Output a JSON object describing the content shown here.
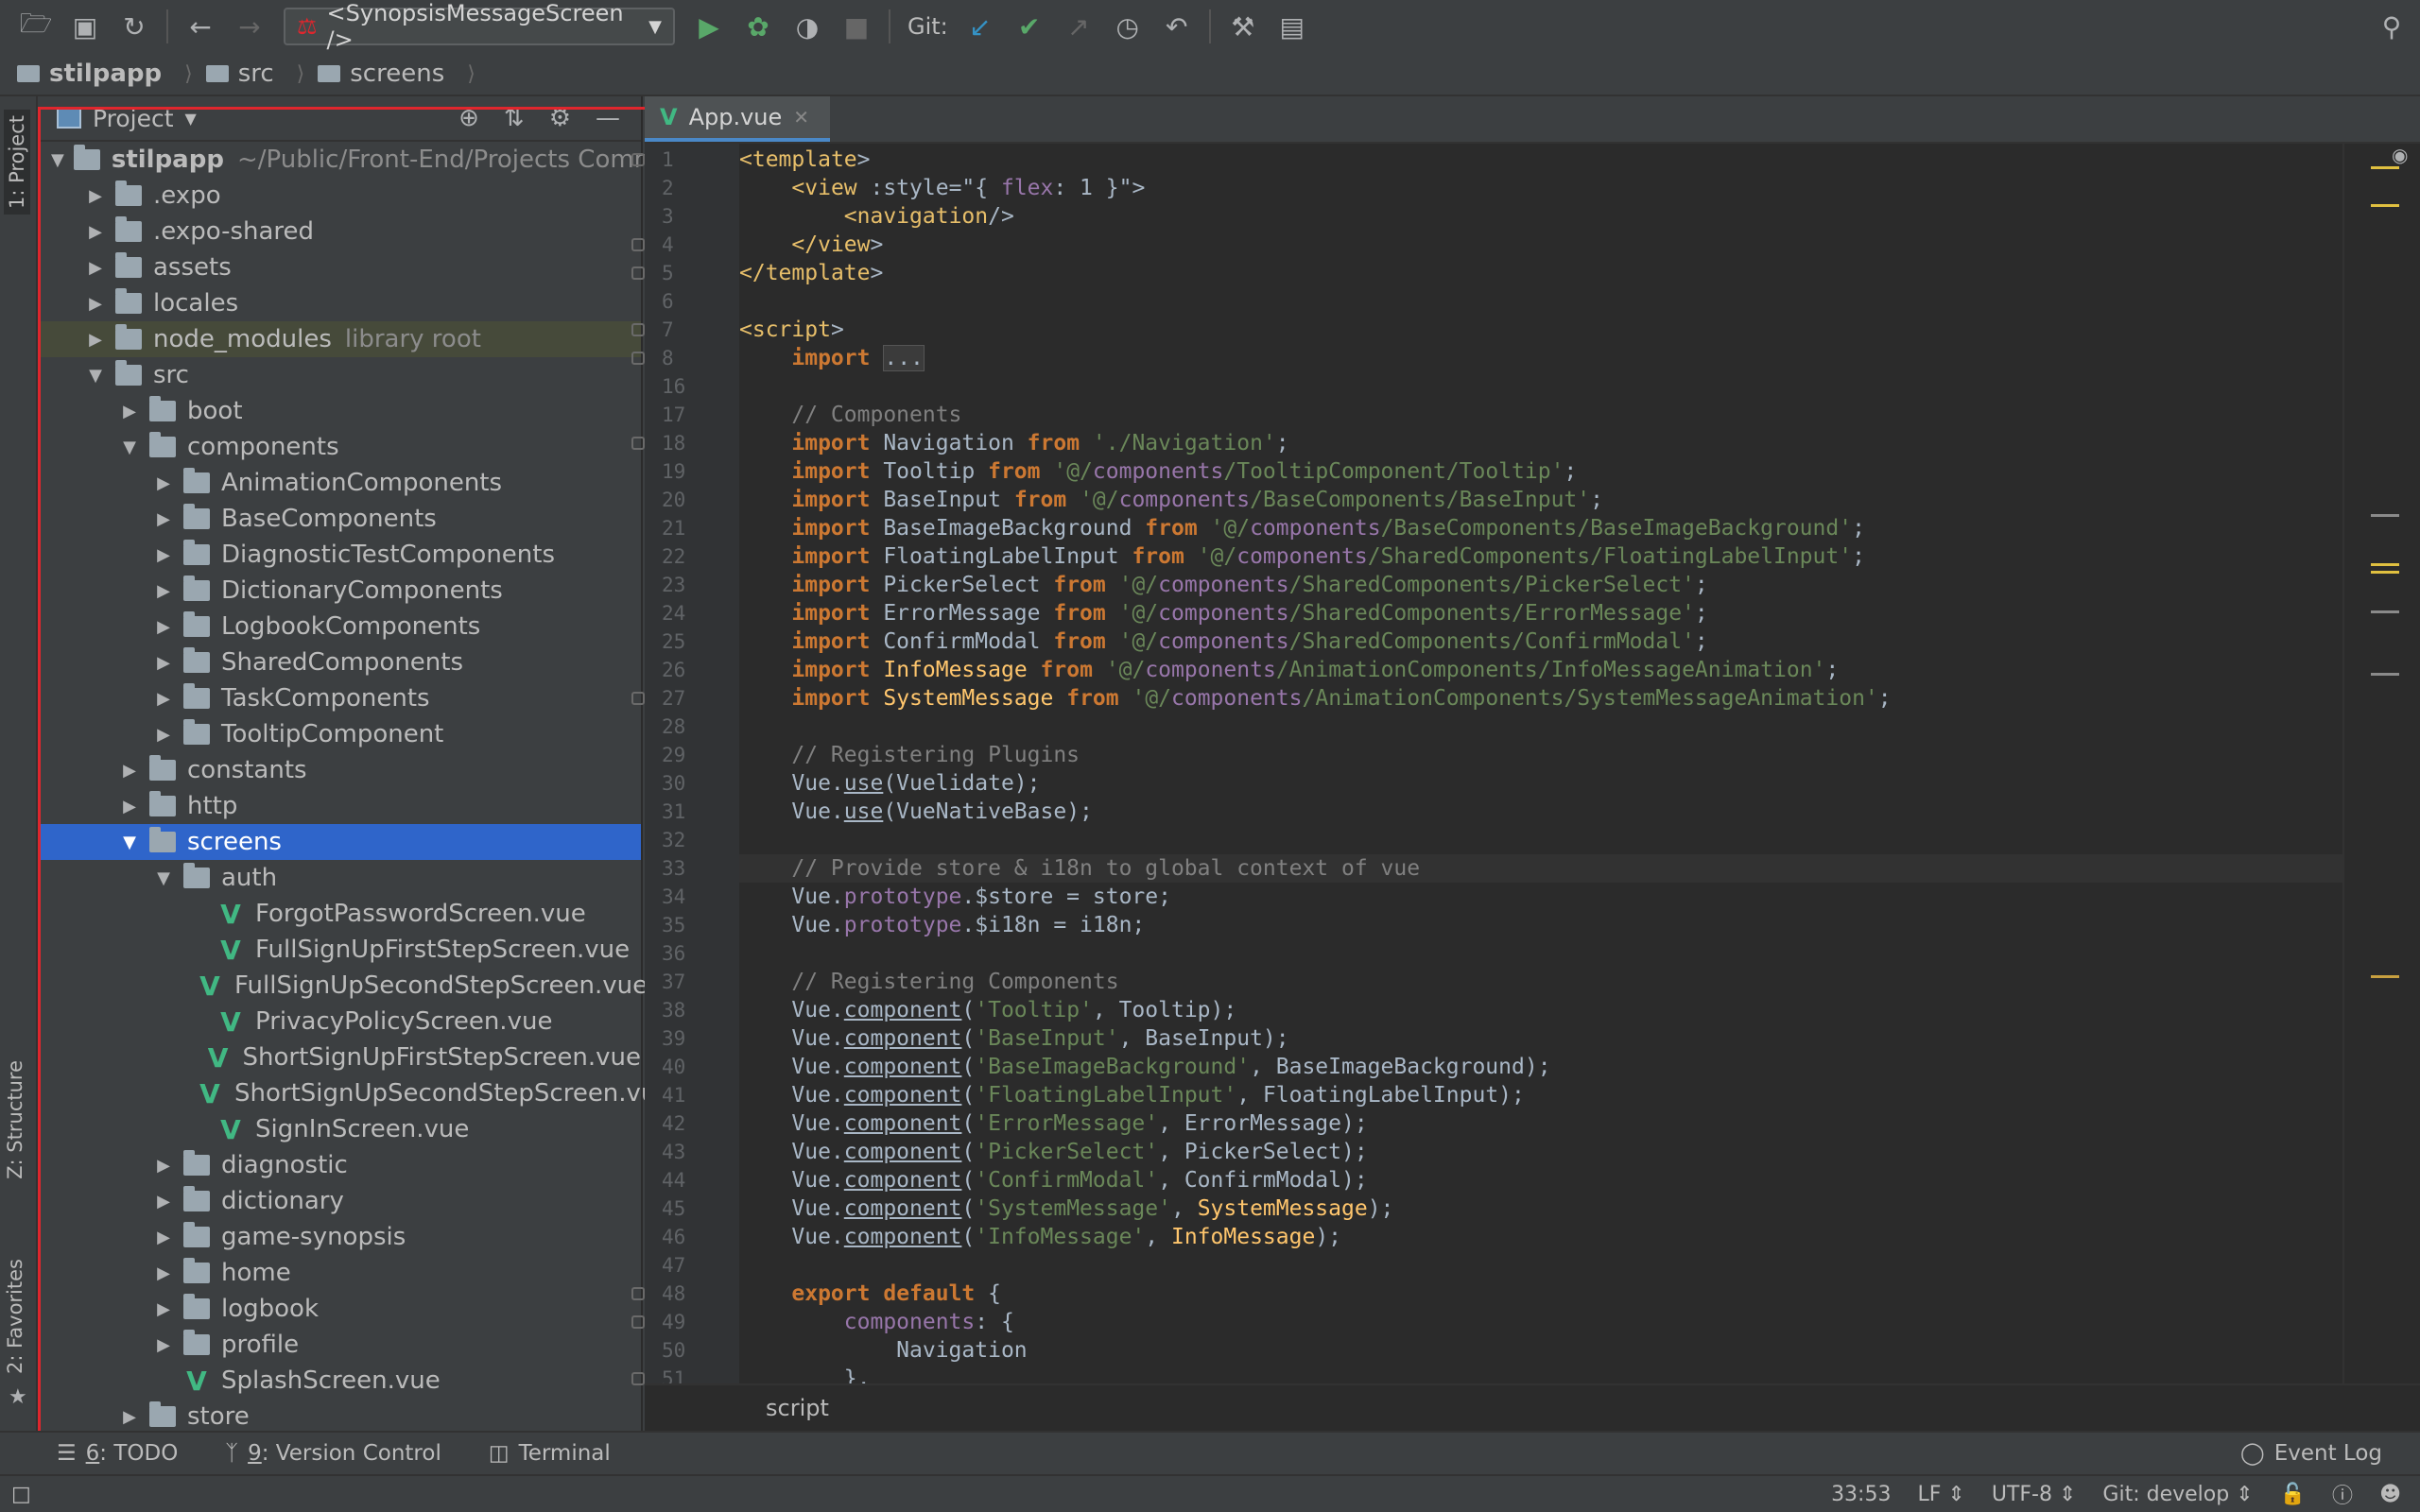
{
  "toolbar": {
    "run_config": "<SynopsisMessageScreen />",
    "git_label": "Git:"
  },
  "breadcrumb": [
    "stilpapp",
    "src",
    "screens"
  ],
  "side_tabs": {
    "project": "1: Project",
    "structure": "Z: Structure",
    "favorites": "2: Favorites"
  },
  "project_panel": {
    "title": "Project",
    "root_name": "stilpapp",
    "root_path": "~/Public/Front-End/Projects Comm",
    "items": [
      {
        "label": "stilpapp",
        "kind": "root",
        "suffix": "~/Public/Front-End/Projects Comm"
      },
      {
        "label": ".expo"
      },
      {
        "label": ".expo-shared"
      },
      {
        "label": "assets"
      },
      {
        "label": "locales"
      },
      {
        "label": "node_modules",
        "suffix": "library root"
      },
      {
        "label": "src"
      },
      {
        "label": "boot"
      },
      {
        "label": "components"
      },
      {
        "label": "AnimationComponents"
      },
      {
        "label": "BaseComponents"
      },
      {
        "label": "DiagnosticTestComponents"
      },
      {
        "label": "DictionaryComponents"
      },
      {
        "label": "LogbookComponents"
      },
      {
        "label": "SharedComponents"
      },
      {
        "label": "TaskComponents"
      },
      {
        "label": "TooltipComponent"
      },
      {
        "label": "constants"
      },
      {
        "label": "http"
      },
      {
        "label": "screens"
      },
      {
        "label": "auth"
      },
      {
        "label": "ForgotPasswordScreen.vue"
      },
      {
        "label": "FullSignUpFirstStepScreen.vue"
      },
      {
        "label": "FullSignUpSecondStepScreen.vue"
      },
      {
        "label": "PrivacyPolicyScreen.vue"
      },
      {
        "label": "ShortSignUpFirstStepScreen.vue"
      },
      {
        "label": "ShortSignUpSecondStepScreen.vue"
      },
      {
        "label": "SignInScreen.vue"
      },
      {
        "label": "diagnostic"
      },
      {
        "label": "dictionary"
      },
      {
        "label": "game-synopsis"
      },
      {
        "label": "home"
      },
      {
        "label": "logbook"
      },
      {
        "label": "profile"
      },
      {
        "label": "SplashScreen.vue"
      },
      {
        "label": "store"
      }
    ]
  },
  "editor": {
    "tab": "App.vue",
    "line_numbers": [
      "1",
      "2",
      "3",
      "4",
      "5",
      "6",
      "7",
      "8",
      "16",
      "17",
      "18",
      "19",
      "20",
      "21",
      "22",
      "23",
      "24",
      "25",
      "26",
      "27",
      "28",
      "29",
      "30",
      "31",
      "32",
      "33",
      "34",
      "35",
      "36",
      "37",
      "38",
      "39",
      "40",
      "41",
      "42",
      "43",
      "44",
      "45",
      "46",
      "47",
      "48",
      "49",
      "50",
      "51"
    ],
    "lines": [
      "<template>",
      "    <view :style=\"{ flex: 1 }\">",
      "        <navigation/>",
      "    </view>",
      "</template>",
      "",
      "<script>",
      "    import ...",
      "",
      "    // Components",
      "    import Navigation from './Navigation';",
      "    import Tooltip from '@/components/TooltipComponent/Tooltip';",
      "    import BaseInput from '@/components/BaseComponents/BaseInput';",
      "    import BaseImageBackground from '@/components/BaseComponents/BaseImageBackground';",
      "    import FloatingLabelInput from '@/components/SharedComponents/FloatingLabelInput';",
      "    import PickerSelect from '@/components/SharedComponents/PickerSelect';",
      "    import ErrorMessage from '@/components/SharedComponents/ErrorMessage';",
      "    import ConfirmModal from '@/components/SharedComponents/ConfirmModal';",
      "    import InfoMessage from '@/components/AnimationComponents/InfoMessageAnimation';",
      "    import SystemMessage from '@/components/AnimationComponents/SystemMessageAnimation';",
      "",
      "    // Registering Plugins",
      "    Vue.use(Vuelidate);",
      "    Vue.use(VueNativeBase);",
      "",
      "    // Provide store & i18n to global context of vue",
      "    Vue.prototype.$store = store;",
      "    Vue.prototype.$i18n = i18n;",
      "",
      "    // Registering Components",
      "    Vue.component('Tooltip', Tooltip);",
      "    Vue.component('BaseInput', BaseInput);",
      "    Vue.component('BaseImageBackground', BaseImageBackground);",
      "    Vue.component('FloatingLabelInput', FloatingLabelInput);",
      "    Vue.component('ErrorMessage', ErrorMessage);",
      "    Vue.component('PickerSelect', PickerSelect);",
      "    Vue.component('ConfirmModal', ConfirmModal);",
      "    Vue.component('SystemMessage', SystemMessage);",
      "    Vue.component('InfoMessage', InfoMessage);",
      "",
      "    export default {",
      "        components: {",
      "            Navigation",
      "        },"
    ],
    "breadcrumb": "script"
  },
  "bottom_tabs": [
    {
      "num": "6",
      "label": ": TODO"
    },
    {
      "num": "9",
      "label": ": Version Control"
    },
    {
      "num": "",
      "label": "Terminal"
    }
  ],
  "event_log": "Event Log",
  "status": {
    "position": "33:53",
    "line_sep": "LF",
    "encoding": "UTF-8",
    "git_branch": "Git: develop"
  },
  "colors": {
    "selection": "#2f65ca",
    "vue_green": "#41b883",
    "highlight_box": "#e0262d",
    "keyword": "#cc7832",
    "string": "#6a8759"
  }
}
